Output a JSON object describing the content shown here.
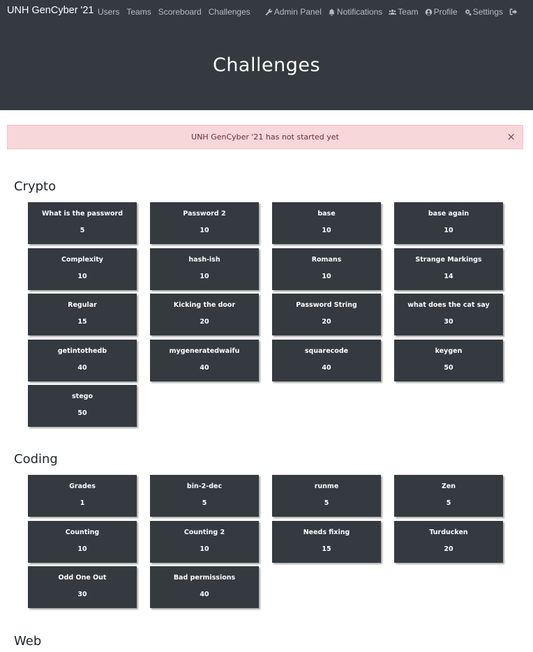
{
  "navbar": {
    "brand": "UNH GenCyber '21",
    "left_links": [
      "Users",
      "Teams",
      "Scoreboard",
      "Challenges"
    ],
    "right_links": [
      {
        "label": "Admin Panel",
        "icon": "wrench-icon"
      },
      {
        "label": "Notifications",
        "icon": "bell-icon"
      },
      {
        "label": "Team",
        "icon": "users-icon"
      },
      {
        "label": "Profile",
        "icon": "user-circle-icon"
      },
      {
        "label": "Settings",
        "icon": "gears-icon"
      }
    ],
    "logout_icon": "logout-icon"
  },
  "page": {
    "title": "Challenges"
  },
  "alert": {
    "message": "UNH GenCyber '21 has not started yet",
    "close": "×"
  },
  "categories": [
    {
      "name": "Crypto",
      "challenges": [
        {
          "name": "What is the password",
          "value": "5"
        },
        {
          "name": "Password 2",
          "value": "10"
        },
        {
          "name": "base",
          "value": "10"
        },
        {
          "name": "base again",
          "value": "10"
        },
        {
          "name": "Complexity",
          "value": "10"
        },
        {
          "name": "hash-ish",
          "value": "10"
        },
        {
          "name": "Romans",
          "value": "10"
        },
        {
          "name": "Strange Markings",
          "value": "14"
        },
        {
          "name": "Regular",
          "value": "15"
        },
        {
          "name": "Kicking the door",
          "value": "20"
        },
        {
          "name": "Password String",
          "value": "20"
        },
        {
          "name": "what does the cat say",
          "value": "30"
        },
        {
          "name": "getintothedb",
          "value": "40"
        },
        {
          "name": "mygeneratedwaifu",
          "value": "40"
        },
        {
          "name": "squarecode",
          "value": "40"
        },
        {
          "name": "keygen",
          "value": "50"
        },
        {
          "name": "stego",
          "value": "50"
        }
      ]
    },
    {
      "name": "Coding",
      "challenges": [
        {
          "name": "Grades",
          "value": "1"
        },
        {
          "name": "bin-2-dec",
          "value": "5"
        },
        {
          "name": "runme",
          "value": "5"
        },
        {
          "name": "Zen",
          "value": "5"
        },
        {
          "name": "Counting",
          "value": "10"
        },
        {
          "name": "Counting 2",
          "value": "10"
        },
        {
          "name": "Needs fixing",
          "value": "15"
        },
        {
          "name": "Turducken",
          "value": "20"
        },
        {
          "name": "Odd One Out",
          "value": "30"
        },
        {
          "name": "Bad permissions",
          "value": "40"
        }
      ]
    },
    {
      "name": "Web",
      "challenges": []
    }
  ],
  "colors": {
    "navbar_bg": "#343a40",
    "tile_bg": "#343a40",
    "alert_bg": "#f8d7da",
    "alert_text": "#6e2c33"
  }
}
